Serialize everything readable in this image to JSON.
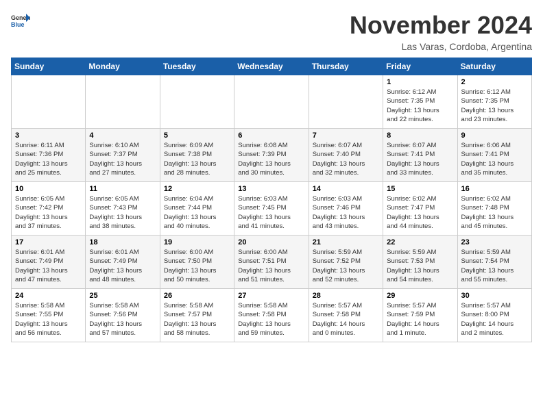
{
  "header": {
    "logo_general": "General",
    "logo_blue": "Blue",
    "month": "November 2024",
    "location": "Las Varas, Cordoba, Argentina"
  },
  "days_of_week": [
    "Sunday",
    "Monday",
    "Tuesday",
    "Wednesday",
    "Thursday",
    "Friday",
    "Saturday"
  ],
  "weeks": [
    [
      {
        "day": "",
        "info": ""
      },
      {
        "day": "",
        "info": ""
      },
      {
        "day": "",
        "info": ""
      },
      {
        "day": "",
        "info": ""
      },
      {
        "day": "",
        "info": ""
      },
      {
        "day": "1",
        "info": "Sunrise: 6:12 AM\nSunset: 7:35 PM\nDaylight: 13 hours\nand 22 minutes."
      },
      {
        "day": "2",
        "info": "Sunrise: 6:12 AM\nSunset: 7:35 PM\nDaylight: 13 hours\nand 23 minutes."
      }
    ],
    [
      {
        "day": "3",
        "info": "Sunrise: 6:11 AM\nSunset: 7:36 PM\nDaylight: 13 hours\nand 25 minutes."
      },
      {
        "day": "4",
        "info": "Sunrise: 6:10 AM\nSunset: 7:37 PM\nDaylight: 13 hours\nand 27 minutes."
      },
      {
        "day": "5",
        "info": "Sunrise: 6:09 AM\nSunset: 7:38 PM\nDaylight: 13 hours\nand 28 minutes."
      },
      {
        "day": "6",
        "info": "Sunrise: 6:08 AM\nSunset: 7:39 PM\nDaylight: 13 hours\nand 30 minutes."
      },
      {
        "day": "7",
        "info": "Sunrise: 6:07 AM\nSunset: 7:40 PM\nDaylight: 13 hours\nand 32 minutes."
      },
      {
        "day": "8",
        "info": "Sunrise: 6:07 AM\nSunset: 7:41 PM\nDaylight: 13 hours\nand 33 minutes."
      },
      {
        "day": "9",
        "info": "Sunrise: 6:06 AM\nSunset: 7:41 PM\nDaylight: 13 hours\nand 35 minutes."
      }
    ],
    [
      {
        "day": "10",
        "info": "Sunrise: 6:05 AM\nSunset: 7:42 PM\nDaylight: 13 hours\nand 37 minutes."
      },
      {
        "day": "11",
        "info": "Sunrise: 6:05 AM\nSunset: 7:43 PM\nDaylight: 13 hours\nand 38 minutes."
      },
      {
        "day": "12",
        "info": "Sunrise: 6:04 AM\nSunset: 7:44 PM\nDaylight: 13 hours\nand 40 minutes."
      },
      {
        "day": "13",
        "info": "Sunrise: 6:03 AM\nSunset: 7:45 PM\nDaylight: 13 hours\nand 41 minutes."
      },
      {
        "day": "14",
        "info": "Sunrise: 6:03 AM\nSunset: 7:46 PM\nDaylight: 13 hours\nand 43 minutes."
      },
      {
        "day": "15",
        "info": "Sunrise: 6:02 AM\nSunset: 7:47 PM\nDaylight: 13 hours\nand 44 minutes."
      },
      {
        "day": "16",
        "info": "Sunrise: 6:02 AM\nSunset: 7:48 PM\nDaylight: 13 hours\nand 45 minutes."
      }
    ],
    [
      {
        "day": "17",
        "info": "Sunrise: 6:01 AM\nSunset: 7:49 PM\nDaylight: 13 hours\nand 47 minutes."
      },
      {
        "day": "18",
        "info": "Sunrise: 6:01 AM\nSunset: 7:49 PM\nDaylight: 13 hours\nand 48 minutes."
      },
      {
        "day": "19",
        "info": "Sunrise: 6:00 AM\nSunset: 7:50 PM\nDaylight: 13 hours\nand 50 minutes."
      },
      {
        "day": "20",
        "info": "Sunrise: 6:00 AM\nSunset: 7:51 PM\nDaylight: 13 hours\nand 51 minutes."
      },
      {
        "day": "21",
        "info": "Sunrise: 5:59 AM\nSunset: 7:52 PM\nDaylight: 13 hours\nand 52 minutes."
      },
      {
        "day": "22",
        "info": "Sunrise: 5:59 AM\nSunset: 7:53 PM\nDaylight: 13 hours\nand 54 minutes."
      },
      {
        "day": "23",
        "info": "Sunrise: 5:59 AM\nSunset: 7:54 PM\nDaylight: 13 hours\nand 55 minutes."
      }
    ],
    [
      {
        "day": "24",
        "info": "Sunrise: 5:58 AM\nSunset: 7:55 PM\nDaylight: 13 hours\nand 56 minutes."
      },
      {
        "day": "25",
        "info": "Sunrise: 5:58 AM\nSunset: 7:56 PM\nDaylight: 13 hours\nand 57 minutes."
      },
      {
        "day": "26",
        "info": "Sunrise: 5:58 AM\nSunset: 7:57 PM\nDaylight: 13 hours\nand 58 minutes."
      },
      {
        "day": "27",
        "info": "Sunrise: 5:58 AM\nSunset: 7:58 PM\nDaylight: 13 hours\nand 59 minutes."
      },
      {
        "day": "28",
        "info": "Sunrise: 5:57 AM\nSunset: 7:58 PM\nDaylight: 14 hours\nand 0 minutes."
      },
      {
        "day": "29",
        "info": "Sunrise: 5:57 AM\nSunset: 7:59 PM\nDaylight: 14 hours\nand 1 minute."
      },
      {
        "day": "30",
        "info": "Sunrise: 5:57 AM\nSunset: 8:00 PM\nDaylight: 14 hours\nand 2 minutes."
      }
    ]
  ]
}
